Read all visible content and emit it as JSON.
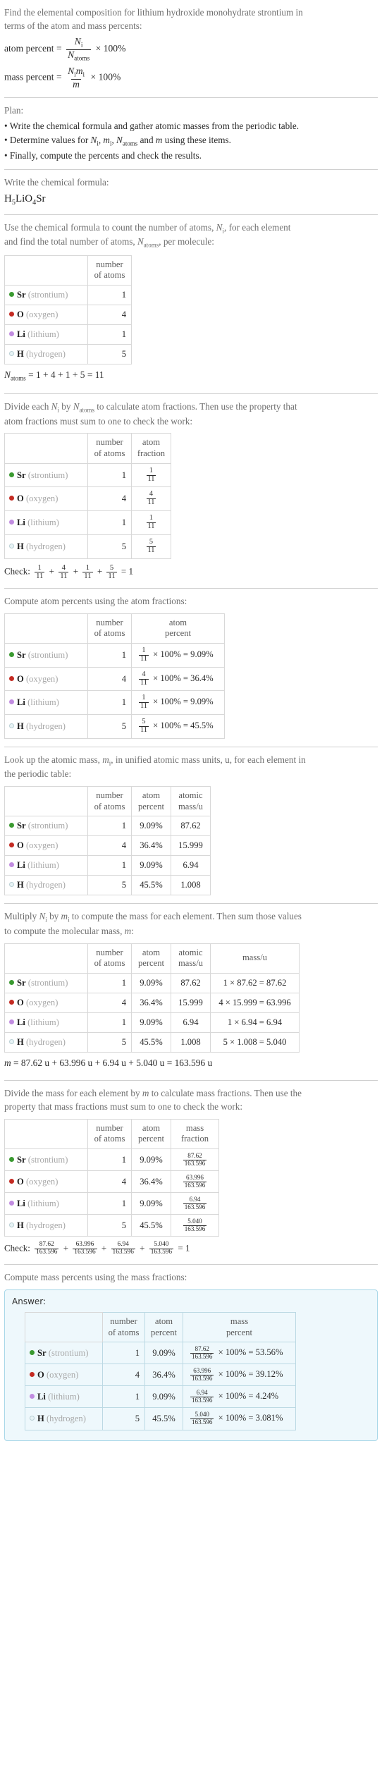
{
  "colors": {
    "Sr": "#3a9a30",
    "O": "#c42b22",
    "Li": "#c18ce0",
    "H": "#e8f4f6",
    "answer_border": "#a9d7e8",
    "answer_bg": "#eef8fc"
  },
  "intro": {
    "line1": "Find the elemental composition for lithium hydroxide monohydrate strontium in",
    "line2": "terms of the atom and mass percents:",
    "atom_percent_label": "atom percent =",
    "atom_percent_num": "N",
    "atom_percent_num_sub": "i",
    "atom_percent_den": "N",
    "atom_percent_den_sub": "atoms",
    "atom_percent_tail": "× 100%",
    "mass_percent_label": "mass percent =",
    "mass_percent_num": "N",
    "mass_percent_num_sub": "i",
    "mass_percent_num2": "m",
    "mass_percent_num2_sub": "i",
    "mass_percent_den": "m",
    "mass_percent_tail": "× 100%"
  },
  "plan": {
    "label": "Plan:",
    "item1": "• Write the chemical formula and gather atomic masses from the periodic table.",
    "item2_a": "• Determine values for ",
    "item2_b": ", ",
    "item2_c": ", ",
    "item2_d": " and ",
    "item2_e": " using these items.",
    "item2_n": "N",
    "item2_n_sub": "i",
    "item2_m": "m",
    "item2_m_sub": "i",
    "item2_natoms": "N",
    "item2_natoms_sub": "atoms",
    "item2_mm": "m",
    "item3": "• Finally, compute the percents and check the results."
  },
  "formula_section": {
    "prompt": "Write the chemical formula:",
    "formula_parts": [
      {
        "t": "H",
        "sub": "5"
      },
      {
        "t": "Li",
        "sub": ""
      },
      {
        "t": "O",
        "sub": "4"
      },
      {
        "t": "Sr",
        "sub": ""
      }
    ],
    "formula_text": "H5LiO4Sr"
  },
  "count_section": {
    "prompt_line1": "Use the chemical formula to count the number of atoms, ",
    "prompt_n": "N",
    "prompt_n_sub": "i",
    "prompt_line1_tail": ", for each element",
    "prompt_line2": "and find the total number of atoms, ",
    "prompt_natoms": "N",
    "prompt_natoms_sub": "atoms",
    "prompt_line2_tail": ", per molecule:",
    "headers": [
      "",
      "number\nof atoms"
    ],
    "header_number_l1": "number",
    "header_number_l2": "of atoms",
    "rows": [
      {
        "sym": "Sr",
        "name": "(strontium)",
        "color": "#3a9a30",
        "count": "1"
      },
      {
        "sym": "O",
        "name": "(oxygen)",
        "color": "#c42b22",
        "count": "4"
      },
      {
        "sym": "Li",
        "name": "(lithium)",
        "color": "#c18ce0",
        "count": "1"
      },
      {
        "sym": "H",
        "name": "(hydrogen)",
        "color": "#e8f4f6",
        "count": "5"
      }
    ],
    "total_label_n": "N",
    "total_label_sub": "atoms",
    "total_expr": "= 1 + 4 + 1 + 5 = 11"
  },
  "atom_fraction_section": {
    "prompt_a": "Divide each ",
    "prompt_n": "N",
    "prompt_n_sub": "i",
    "prompt_b": " by ",
    "prompt_natoms": "N",
    "prompt_natoms_sub": "atoms",
    "prompt_c": " to calculate atom fractions. Then use the property that",
    "prompt_line2": "atom fractions must sum to one to check the work:",
    "header_number_l1": "number",
    "header_number_l2": "of atoms",
    "header_frac_l1": "atom",
    "header_frac_l2": "fraction",
    "rows": [
      {
        "sym": "Sr",
        "name": "(strontium)",
        "color": "#3a9a30",
        "count": "1",
        "num": "1",
        "den": "11"
      },
      {
        "sym": "O",
        "name": "(oxygen)",
        "color": "#c42b22",
        "count": "4",
        "num": "4",
        "den": "11"
      },
      {
        "sym": "Li",
        "name": "(lithium)",
        "color": "#c18ce0",
        "count": "1",
        "num": "1",
        "den": "11"
      },
      {
        "sym": "H",
        "name": "(hydrogen)",
        "color": "#e8f4f6",
        "count": "5",
        "num": "5",
        "den": "11"
      }
    ],
    "check_label": "Check:",
    "check_terms": [
      {
        "num": "1",
        "den": "11"
      },
      {
        "num": "4",
        "den": "11"
      },
      {
        "num": "1",
        "den": "11"
      },
      {
        "num": "5",
        "den": "11"
      }
    ],
    "check_result": "= 1"
  },
  "atom_percent_section": {
    "prompt": "Compute atom percents using the atom fractions:",
    "header_number_l1": "number",
    "header_number_l2": "of atoms",
    "header_pct_l1": "atom",
    "header_pct_l2": "percent",
    "rows": [
      {
        "sym": "Sr",
        "name": "(strontium)",
        "color": "#3a9a30",
        "count": "1",
        "num": "1",
        "den": "11",
        "expr": "× 100% = 9.09%"
      },
      {
        "sym": "O",
        "name": "(oxygen)",
        "color": "#c42b22",
        "count": "4",
        "num": "4",
        "den": "11",
        "expr": "× 100% = 36.4%"
      },
      {
        "sym": "Li",
        "name": "(lithium)",
        "color": "#c18ce0",
        "count": "1",
        "num": "1",
        "den": "11",
        "expr": "× 100% = 9.09%"
      },
      {
        "sym": "H",
        "name": "(hydrogen)",
        "color": "#e8f4f6",
        "count": "5",
        "num": "5",
        "den": "11",
        "expr": "× 100% = 45.5%"
      }
    ]
  },
  "atomic_mass_section": {
    "prompt_a": "Look up the atomic mass, ",
    "prompt_m": "m",
    "prompt_m_sub": "i",
    "prompt_b": ", in unified atomic mass units, u, for each element in",
    "prompt_line2": "the periodic table:",
    "header_number_l1": "number",
    "header_number_l2": "of atoms",
    "header_pct_l1": "atom",
    "header_pct_l2": "percent",
    "header_mass_l1": "atomic",
    "header_mass_l2": "mass/u",
    "rows": [
      {
        "sym": "Sr",
        "name": "(strontium)",
        "color": "#3a9a30",
        "count": "1",
        "pct": "9.09%",
        "mass": "87.62"
      },
      {
        "sym": "O",
        "name": "(oxygen)",
        "color": "#c42b22",
        "count": "4",
        "pct": "36.4%",
        "mass": "15.999"
      },
      {
        "sym": "Li",
        "name": "(lithium)",
        "color": "#c18ce0",
        "count": "1",
        "pct": "9.09%",
        "mass": "6.94"
      },
      {
        "sym": "H",
        "name": "(hydrogen)",
        "color": "#e8f4f6",
        "count": "5",
        "pct": "45.5%",
        "mass": "1.008"
      }
    ]
  },
  "mass_section": {
    "prompt_a": "Multiply ",
    "prompt_n": "N",
    "prompt_n_sub": "i",
    "prompt_b": " by ",
    "prompt_m": "m",
    "prompt_m_sub": "i",
    "prompt_c": " to compute the mass for each element. Then sum those values",
    "prompt_line2_a": "to compute the molecular mass, ",
    "prompt_mm": "m",
    "prompt_line2_b": ":",
    "header_number_l1": "number",
    "header_number_l2": "of atoms",
    "header_pct_l1": "atom",
    "header_pct_l2": "percent",
    "header_amass_l1": "atomic",
    "header_amass_l2": "mass/u",
    "header_mass_l1": "mass/u",
    "header_mass_l2": "",
    "rows": [
      {
        "sym": "Sr",
        "name": "(strontium)",
        "color": "#3a9a30",
        "count": "1",
        "pct": "9.09%",
        "amass": "87.62",
        "mass": "1 × 87.62 = 87.62"
      },
      {
        "sym": "O",
        "name": "(oxygen)",
        "color": "#c42b22",
        "count": "4",
        "pct": "36.4%",
        "amass": "15.999",
        "mass": "4 × 15.999 = 63.996"
      },
      {
        "sym": "Li",
        "name": "(lithium)",
        "color": "#c18ce0",
        "count": "1",
        "pct": "9.09%",
        "amass": "6.94",
        "mass": "1 × 6.94 = 6.94"
      },
      {
        "sym": "H",
        "name": "(hydrogen)",
        "color": "#e8f4f6",
        "count": "5",
        "pct": "45.5%",
        "amass": "1.008",
        "mass": "5 × 1.008 = 5.040"
      }
    ],
    "total_sym": "m",
    "total_expr": "= 87.62 u + 63.996 u + 6.94 u + 5.040 u = 163.596 u"
  },
  "mass_fraction_section": {
    "prompt_a": "Divide the mass for each element by ",
    "prompt_m": "m",
    "prompt_b": " to calculate mass fractions. Then use the",
    "prompt_line2": "property that mass fractions must sum to one to check the work:",
    "header_number_l1": "number",
    "header_number_l2": "of atoms",
    "header_pct_l1": "atom",
    "header_pct_l2": "percent",
    "header_mf_l1": "mass",
    "header_mf_l2": "fraction",
    "rows": [
      {
        "sym": "Sr",
        "name": "(strontium)",
        "color": "#3a9a30",
        "count": "1",
        "pct": "9.09%",
        "num": "87.62",
        "den": "163.596"
      },
      {
        "sym": "O",
        "name": "(oxygen)",
        "color": "#c42b22",
        "count": "4",
        "pct": "36.4%",
        "num": "63.996",
        "den": "163.596"
      },
      {
        "sym": "Li",
        "name": "(lithium)",
        "color": "#c18ce0",
        "count": "1",
        "pct": "9.09%",
        "num": "6.94",
        "den": "163.596"
      },
      {
        "sym": "H",
        "name": "(hydrogen)",
        "color": "#e8f4f6",
        "count": "5",
        "pct": "45.5%",
        "num": "5.040",
        "den": "163.596"
      }
    ],
    "check_label": "Check:",
    "check_terms": [
      {
        "num": "87.62",
        "den": "163.596"
      },
      {
        "num": "63.996",
        "den": "163.596"
      },
      {
        "num": "6.94",
        "den": "163.596"
      },
      {
        "num": "5.040",
        "den": "163.596"
      }
    ],
    "check_result": "= 1"
  },
  "mass_percent_section": {
    "prompt": "Compute mass percents using the mass fractions:",
    "answer_label": "Answer:",
    "header_number_l1": "number",
    "header_number_l2": "of atoms",
    "header_pct_l1": "atom",
    "header_pct_l2": "percent",
    "header_mp_l1": "mass",
    "header_mp_l2": "percent",
    "rows": [
      {
        "sym": "Sr",
        "name": "(strontium)",
        "color": "#3a9a30",
        "count": "1",
        "pct": "9.09%",
        "num": "87.62",
        "den": "163.596",
        "expr": "× 100% = 53.56%"
      },
      {
        "sym": "O",
        "name": "(oxygen)",
        "color": "#c42b22",
        "count": "4",
        "pct": "36.4%",
        "num": "63.996",
        "den": "163.596",
        "expr": "× 100% = 39.12%"
      },
      {
        "sym": "Li",
        "name": "(lithium)",
        "color": "#c18ce0",
        "count": "1",
        "pct": "9.09%",
        "num": "6.94",
        "den": "163.596",
        "expr": "× 100% = 4.24%"
      },
      {
        "sym": "H",
        "name": "(hydrogen)",
        "color": "#e8f4f6",
        "count": "5",
        "pct": "45.5%",
        "num": "5.040",
        "den": "163.596",
        "expr": "× 100% = 3.081%"
      }
    ]
  }
}
